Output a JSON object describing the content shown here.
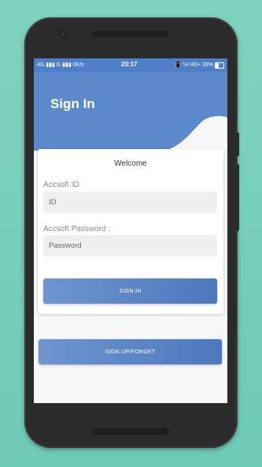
{
  "status_bar": {
    "left": "4G ▮▮▮ G ▮▮▮ 0K/s",
    "time": "20:17",
    "right": "📳 ¼⁄ 4G+ 33%"
  },
  "header": {
    "title": "Sign In"
  },
  "card": {
    "welcome": "Welcome",
    "id_label": "Accsoft ID",
    "id_placeholder": "ID",
    "password_label": "Accsoft Password :",
    "password_placeholder": "Password",
    "sign_in_label": "SIGN IN"
  },
  "secondary": {
    "signup_label": "SIGN UP/FORGET"
  },
  "colors": {
    "primary": "#5b89cc",
    "status_bar": "#4f7fc8",
    "background": "#7fd3be"
  }
}
